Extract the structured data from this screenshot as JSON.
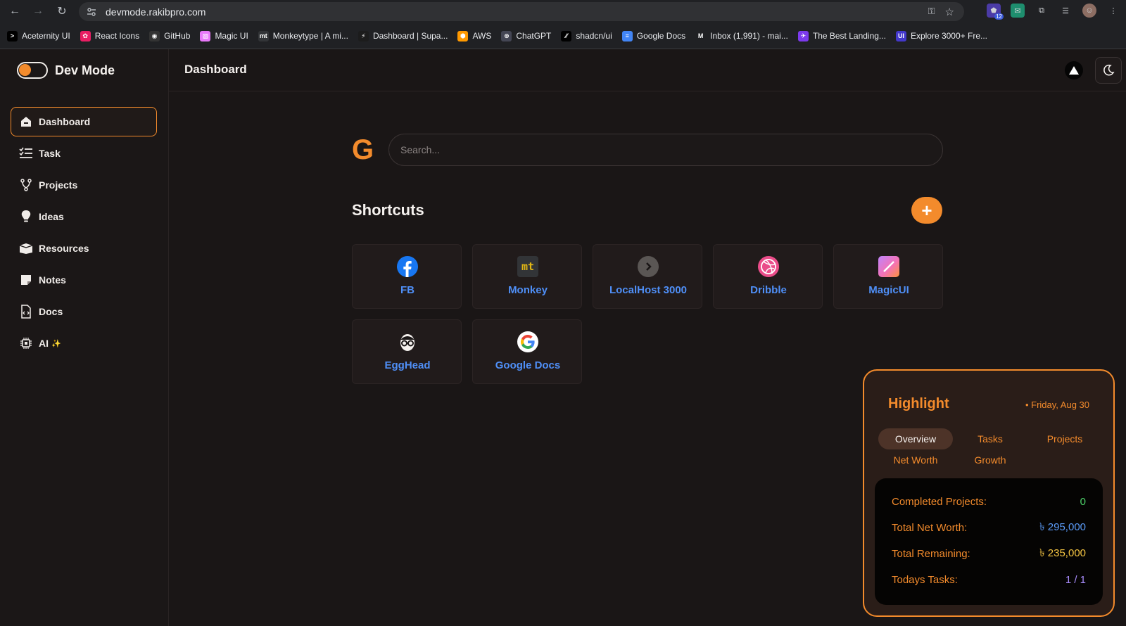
{
  "browser": {
    "url": "devmode.rakibpro.com",
    "bookmarks": [
      {
        "label": "Aceternity UI",
        "color": "#000000",
        "glyph": ">"
      },
      {
        "label": "React Icons",
        "color": "#e91e63",
        "glyph": "✿"
      },
      {
        "label": "GitHub",
        "color": "#333333",
        "glyph": "◉"
      },
      {
        "label": "Magic UI",
        "color": "#e879f9",
        "glyph": "▨"
      },
      {
        "label": "Monkeytype | A mi...",
        "color": "#323437",
        "glyph": "mt"
      },
      {
        "label": "Dashboard | Supa...",
        "color": "#1c1c1c",
        "glyph": "⚡"
      },
      {
        "label": "AWS",
        "color": "#ff9900",
        "glyph": "⬢"
      },
      {
        "label": "ChatGPT",
        "color": "#444654",
        "glyph": "⊛"
      },
      {
        "label": "shadcn/ui",
        "color": "#000000",
        "glyph": "⁄⁄"
      },
      {
        "label": "Google Docs",
        "color": "#4285f4",
        "glyph": "≡"
      },
      {
        "label": "Inbox (1,991) - mai...",
        "color": "#202124",
        "glyph": "M"
      },
      {
        "label": "The Best Landing...",
        "color": "#7c3aed",
        "glyph": "✈"
      },
      {
        "label": "Explore 3000+ Fre...",
        "color": "#4338ca",
        "glyph": "UI"
      }
    ],
    "ext_badge": "12"
  },
  "app": {
    "brand": "Dev Mode",
    "page_title": "Dashboard",
    "nav": [
      {
        "label": "Dashboard",
        "icon": "home-icon"
      },
      {
        "label": "Task",
        "icon": "checklist-icon"
      },
      {
        "label": "Projects",
        "icon": "branch-icon"
      },
      {
        "label": "Ideas",
        "icon": "lightbulb-icon"
      },
      {
        "label": "Resources",
        "icon": "box-icon"
      },
      {
        "label": "Notes",
        "icon": "note-icon"
      },
      {
        "label": "Docs",
        "icon": "doc-icon"
      },
      {
        "label": "AI",
        "icon": "chip-icon"
      }
    ],
    "ai_sparkle": "✨"
  },
  "search": {
    "logo": "G",
    "placeholder": "Search..."
  },
  "shortcuts": {
    "title": "Shortcuts",
    "add_label": "+",
    "items": [
      {
        "label": "FB",
        "icon": "facebook-icon"
      },
      {
        "label": "Monkey",
        "icon": "monkeytype-icon"
      },
      {
        "label": "LocalHost 3000",
        "icon": "chevron-right-icon"
      },
      {
        "label": "Dribble",
        "icon": "dribbble-icon"
      },
      {
        "label": "MagicUI",
        "icon": "magicui-icon"
      },
      {
        "label": "EggHead",
        "icon": "egghead-icon"
      },
      {
        "label": "Google Docs",
        "icon": "google-icon"
      }
    ]
  },
  "highlight": {
    "title": "Highlight",
    "date": "• Friday, Aug 30",
    "tabs": [
      "Overview",
      "Tasks",
      "Projects",
      "Net Worth",
      "Growth"
    ],
    "active_tab": "Overview",
    "stats": [
      {
        "label": "Completed Projects:",
        "value": "0",
        "color": "#4ed36a"
      },
      {
        "label": "Total Net Worth:",
        "value": "৳ 295,000",
        "color": "#5b9bf8"
      },
      {
        "label": "Total Remaining:",
        "value": "৳ 235,000",
        "color": "#f5c542"
      },
      {
        "label": "Todays Tasks:",
        "value": "1 / 1",
        "color": "#a78bfa"
      }
    ]
  },
  "colors": {
    "accent": "#f38b2c",
    "background": "#1a1616",
    "link": "#4f8ff7"
  }
}
